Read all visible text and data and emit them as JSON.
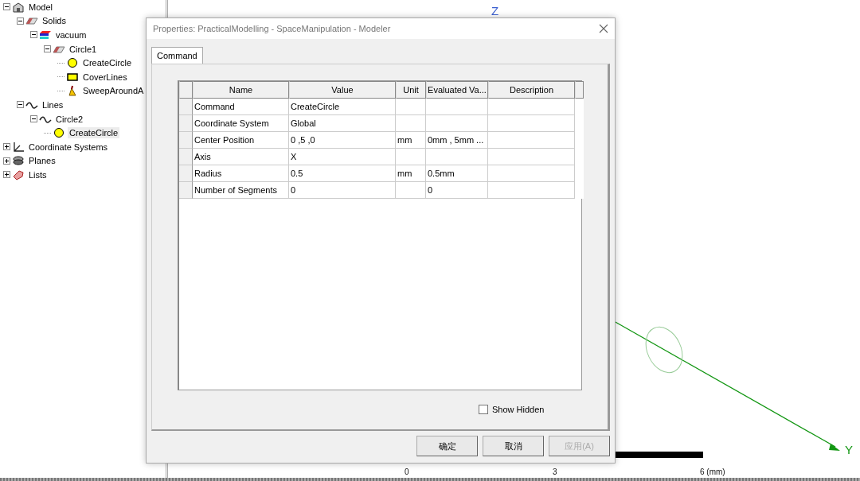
{
  "tree": [
    {
      "label": "Model",
      "kind": "model",
      "expanded": true,
      "selected": false,
      "children": [
        {
          "label": "Solids",
          "kind": "solid",
          "expanded": true,
          "selected": false,
          "children": [
            {
              "label": "vacuum",
              "kind": "material",
              "expanded": true,
              "selected": false,
              "children": [
                {
                  "label": "Circle1",
                  "kind": "solid",
                  "expanded": true,
                  "selected": false,
                  "children": [
                    {
                      "label": "CreateCircle",
                      "kind": "circle",
                      "selected": false
                    },
                    {
                      "label": "CoverLines",
                      "kind": "cover",
                      "selected": false
                    },
                    {
                      "label": "SweepAroundA",
                      "kind": "sweep",
                      "selected": false
                    }
                  ]
                }
              ]
            }
          ]
        },
        {
          "label": "Lines",
          "kind": "line",
          "expanded": true,
          "selected": false,
          "children": [
            {
              "label": "Circle2",
              "kind": "line",
              "expanded": true,
              "selected": false,
              "children": [
                {
                  "label": "CreateCircle",
                  "kind": "circle",
                  "selected": true
                }
              ]
            }
          ]
        }
      ]
    },
    {
      "label": "Coordinate Systems",
      "kind": "coords",
      "expanded": false,
      "selected": false
    },
    {
      "label": "Planes",
      "kind": "planes",
      "expanded": false,
      "selected": false
    },
    {
      "label": "Lists",
      "kind": "lists",
      "expanded": false,
      "selected": false
    }
  ],
  "viewport": {
    "axis_labels": [
      {
        "kind": "z",
        "text": "Z"
      },
      {
        "kind": "y",
        "text": "Y"
      }
    ],
    "scale_ticks": [
      "0",
      "3",
      "6 (mm)"
    ]
  },
  "dialog": {
    "title": "Properties: PracticalModelling - SpaceManipulation - Modeler",
    "tabs": [
      {
        "label": "Command",
        "selected": true
      }
    ],
    "table": {
      "columns": [
        "Name",
        "Value",
        "Unit",
        "Evaluated Va...",
        "Description"
      ],
      "rows": [
        {
          "name": "Command",
          "value": "CreateCircle"
        },
        {
          "name": "Coordinate System",
          "value": "Global"
        },
        {
          "name": "Center Position",
          "value": "0 ,5 ,0",
          "unit": "mm",
          "evaluated": "0mm , 5mm ..."
        },
        {
          "name": "Axis",
          "value": "X"
        },
        {
          "name": "Radius",
          "value": "0.5",
          "unit": "mm",
          "evaluated": "0.5mm"
        },
        {
          "name": "Number of Segments",
          "value": "0",
          "evaluated": "0"
        }
      ]
    },
    "show_hidden": {
      "label": "Show Hidden",
      "checked": false
    },
    "buttons": [
      {
        "label": "确定",
        "disabled": false
      },
      {
        "label": "取消",
        "disabled": false
      },
      {
        "label": "应用(A)",
        "disabled": true
      }
    ]
  }
}
